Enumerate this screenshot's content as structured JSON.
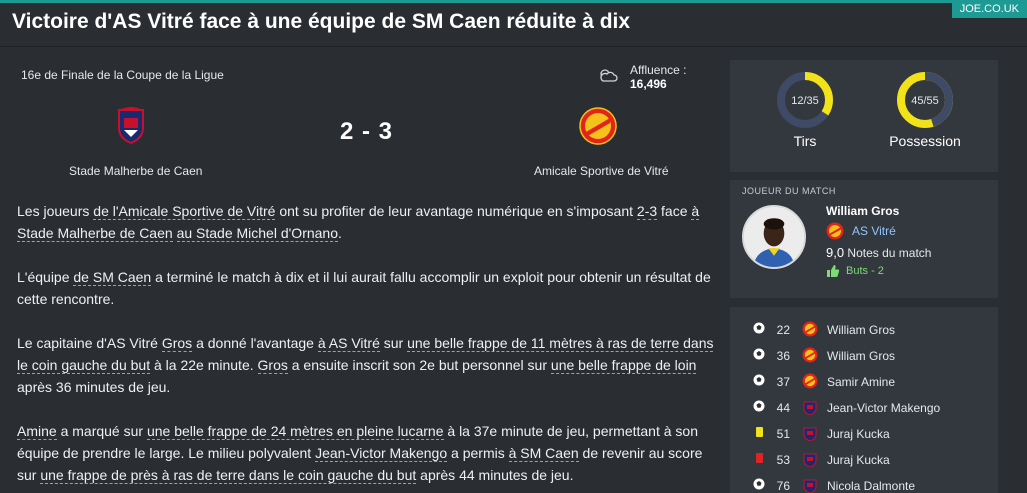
{
  "source": "JOE.CO.UK",
  "headline": "Victoire d'AS Vitré face à une équipe de SM Caen réduite à dix",
  "match": {
    "competition": "16e de Finale de la Coupe de la Ligue",
    "attendance_label": "Affluence :",
    "attendance_value": "16,496",
    "score": "2 - 3",
    "home_team": "Stade Malherbe de Caen",
    "away_team": "Amicale Sportive de Vitré"
  },
  "report": {
    "p1": [
      "Les joueurs ",
      "de l'Amicale Sportive de Vitré",
      " ont su profiter de leur avantage numérique en s'imposant ",
      "2-3",
      " face ",
      "à Stade Malherbe de Caen",
      " ",
      "au Stade Michel d'Ornano",
      "."
    ],
    "p2": [
      "L'équipe ",
      "de SM Caen",
      " a terminé le match à dix et il lui aurait fallu accomplir un exploit pour obtenir un résultat de cette rencontre."
    ],
    "p3": [
      "Le capitaine d'AS Vitré ",
      "Gros",
      " a donné l'avantage ",
      "à AS Vitré",
      " sur ",
      "une belle frappe de 11 mètres à ras de terre dans le coin gauche du but",
      " à la 22e minute. ",
      "Gros",
      " a ensuite inscrit son 2e but personnel sur ",
      "une belle frappe de loin",
      " après 36 minutes de jeu."
    ],
    "p4": [
      "Amine",
      " a marqué sur ",
      "une belle frappe de 24 mètres en pleine lucarne",
      " à la 37e minute de jeu, permettant à son équipe de prendre le large. Le milieu polyvalent ",
      "Jean-Victor Makengo",
      " a permis ",
      "à SM Caen",
      " de revenir au score sur ",
      "une frappe de près à ras de terre dans le coin gauche du but",
      " après 44 minutes de jeu."
    ]
  },
  "stats": {
    "shots": {
      "value": "12/35",
      "label": "Tirs",
      "fraction": 0.343
    },
    "possession": {
      "value": "45/55",
      "label": "Possession",
      "fraction": 0.45
    },
    "colors": {
      "track": "#3f4a66",
      "fill": "#f2e21a"
    }
  },
  "potm": {
    "title": "JOUEUR DU MATCH",
    "name": "William Gros",
    "club": "AS Vitré",
    "rating": "9,0",
    "rating_label": "Notes du match",
    "goals": "Buts - 2"
  },
  "events": [
    {
      "minute": "22",
      "type": "goal",
      "team": "away",
      "player": "William Gros"
    },
    {
      "minute": "36",
      "type": "goal",
      "team": "away",
      "player": "William Gros"
    },
    {
      "minute": "37",
      "type": "goal",
      "team": "away",
      "player": "Samir Amine"
    },
    {
      "minute": "44",
      "type": "goal",
      "team": "home",
      "player": "Jean-Victor Makengo"
    },
    {
      "minute": "51",
      "type": "yellow-card",
      "team": "home",
      "player": "Juraj Kucka"
    },
    {
      "minute": "53",
      "type": "red-card",
      "team": "home",
      "player": "Juraj Kucka"
    },
    {
      "minute": "76",
      "type": "goal",
      "team": "home",
      "player": "Nicola Dalmonte"
    }
  ]
}
